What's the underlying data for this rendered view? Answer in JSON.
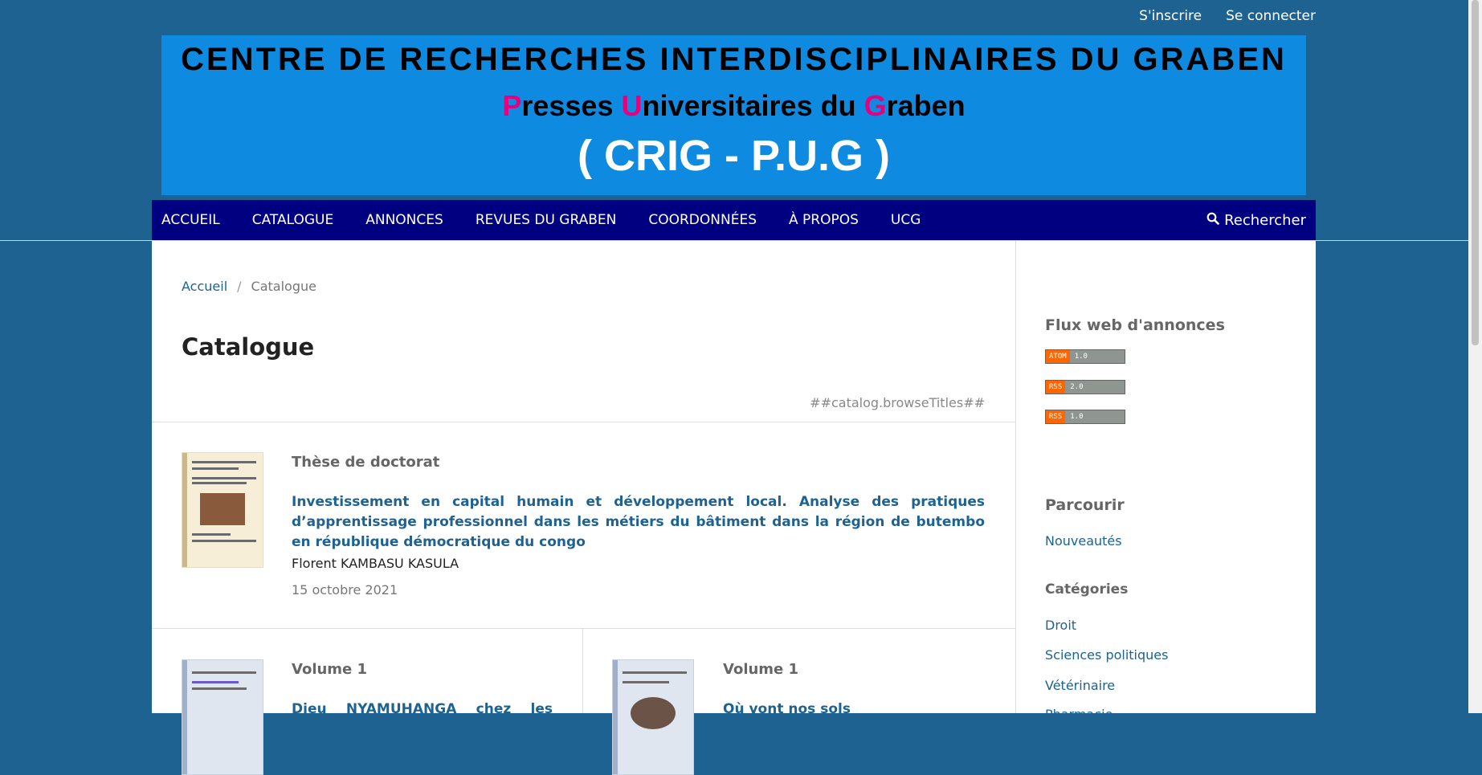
{
  "header": {
    "signup": "S'inscrire",
    "login": "Se connecter"
  },
  "banner": {
    "line1": "CENTRE DE RECHERCHES INTERDISCIPLINAIRES DU GRABEN",
    "line2_p": "P",
    "line2_p_rest": "resses ",
    "line2_u": "U",
    "line2_u_rest": "niversitaires du ",
    "line2_g": "G",
    "line2_g_rest": "raben",
    "line3": "( CRIG - P.U.G )"
  },
  "nav": {
    "items": [
      "ACCUEIL",
      "CATALOGUE",
      "ANNONCES",
      "REVUES DU GRABEN",
      "COORDONNÉES",
      "À PROPOS",
      "UCG"
    ],
    "search_label": "Rechercher",
    "search_icon": "search-icon"
  },
  "breadcrumb": {
    "home": "Accueil",
    "separator": "/",
    "current": "Catalogue"
  },
  "main": {
    "title": "Catalogue",
    "browse_titles": "##catalog.browseTitles##",
    "items": [
      {
        "series": "Thèse de doctorat",
        "title": "Investissement en capital humain et développement local. Analyse des pratiques d’apprentissage professionnel dans les métiers du bâtiment dans la région de butembo en république démocratique du congo",
        "author": "Florent KAMBASU KASULA",
        "date": "15 octobre 2021"
      },
      {
        "series": "Volume 1",
        "title": "Dieu NYAMUHANGA chez les Nande"
      },
      {
        "series": "Volume 1",
        "title": "Où vont nos sols"
      }
    ]
  },
  "sidebar": {
    "feeds_title": "Flux web d'annonces",
    "feeds": [
      {
        "tag": "ATOM",
        "version": "1.0"
      },
      {
        "tag": "RSS",
        "version": "2.0"
      },
      {
        "tag": "RSS",
        "version": "1.0"
      }
    ],
    "browse_title": "Parcourir",
    "new_releases": "Nouveautés",
    "categories_title": "Catégories",
    "categories": [
      "Droit",
      "Sciences politiques",
      "Vétérinaire",
      "Pharmacie"
    ]
  },
  "colors": {
    "background": "#1e6292",
    "navbar": "#000080",
    "banner": "#0e8be0",
    "link": "#1e6292",
    "banner_initials": "#e6007e"
  }
}
